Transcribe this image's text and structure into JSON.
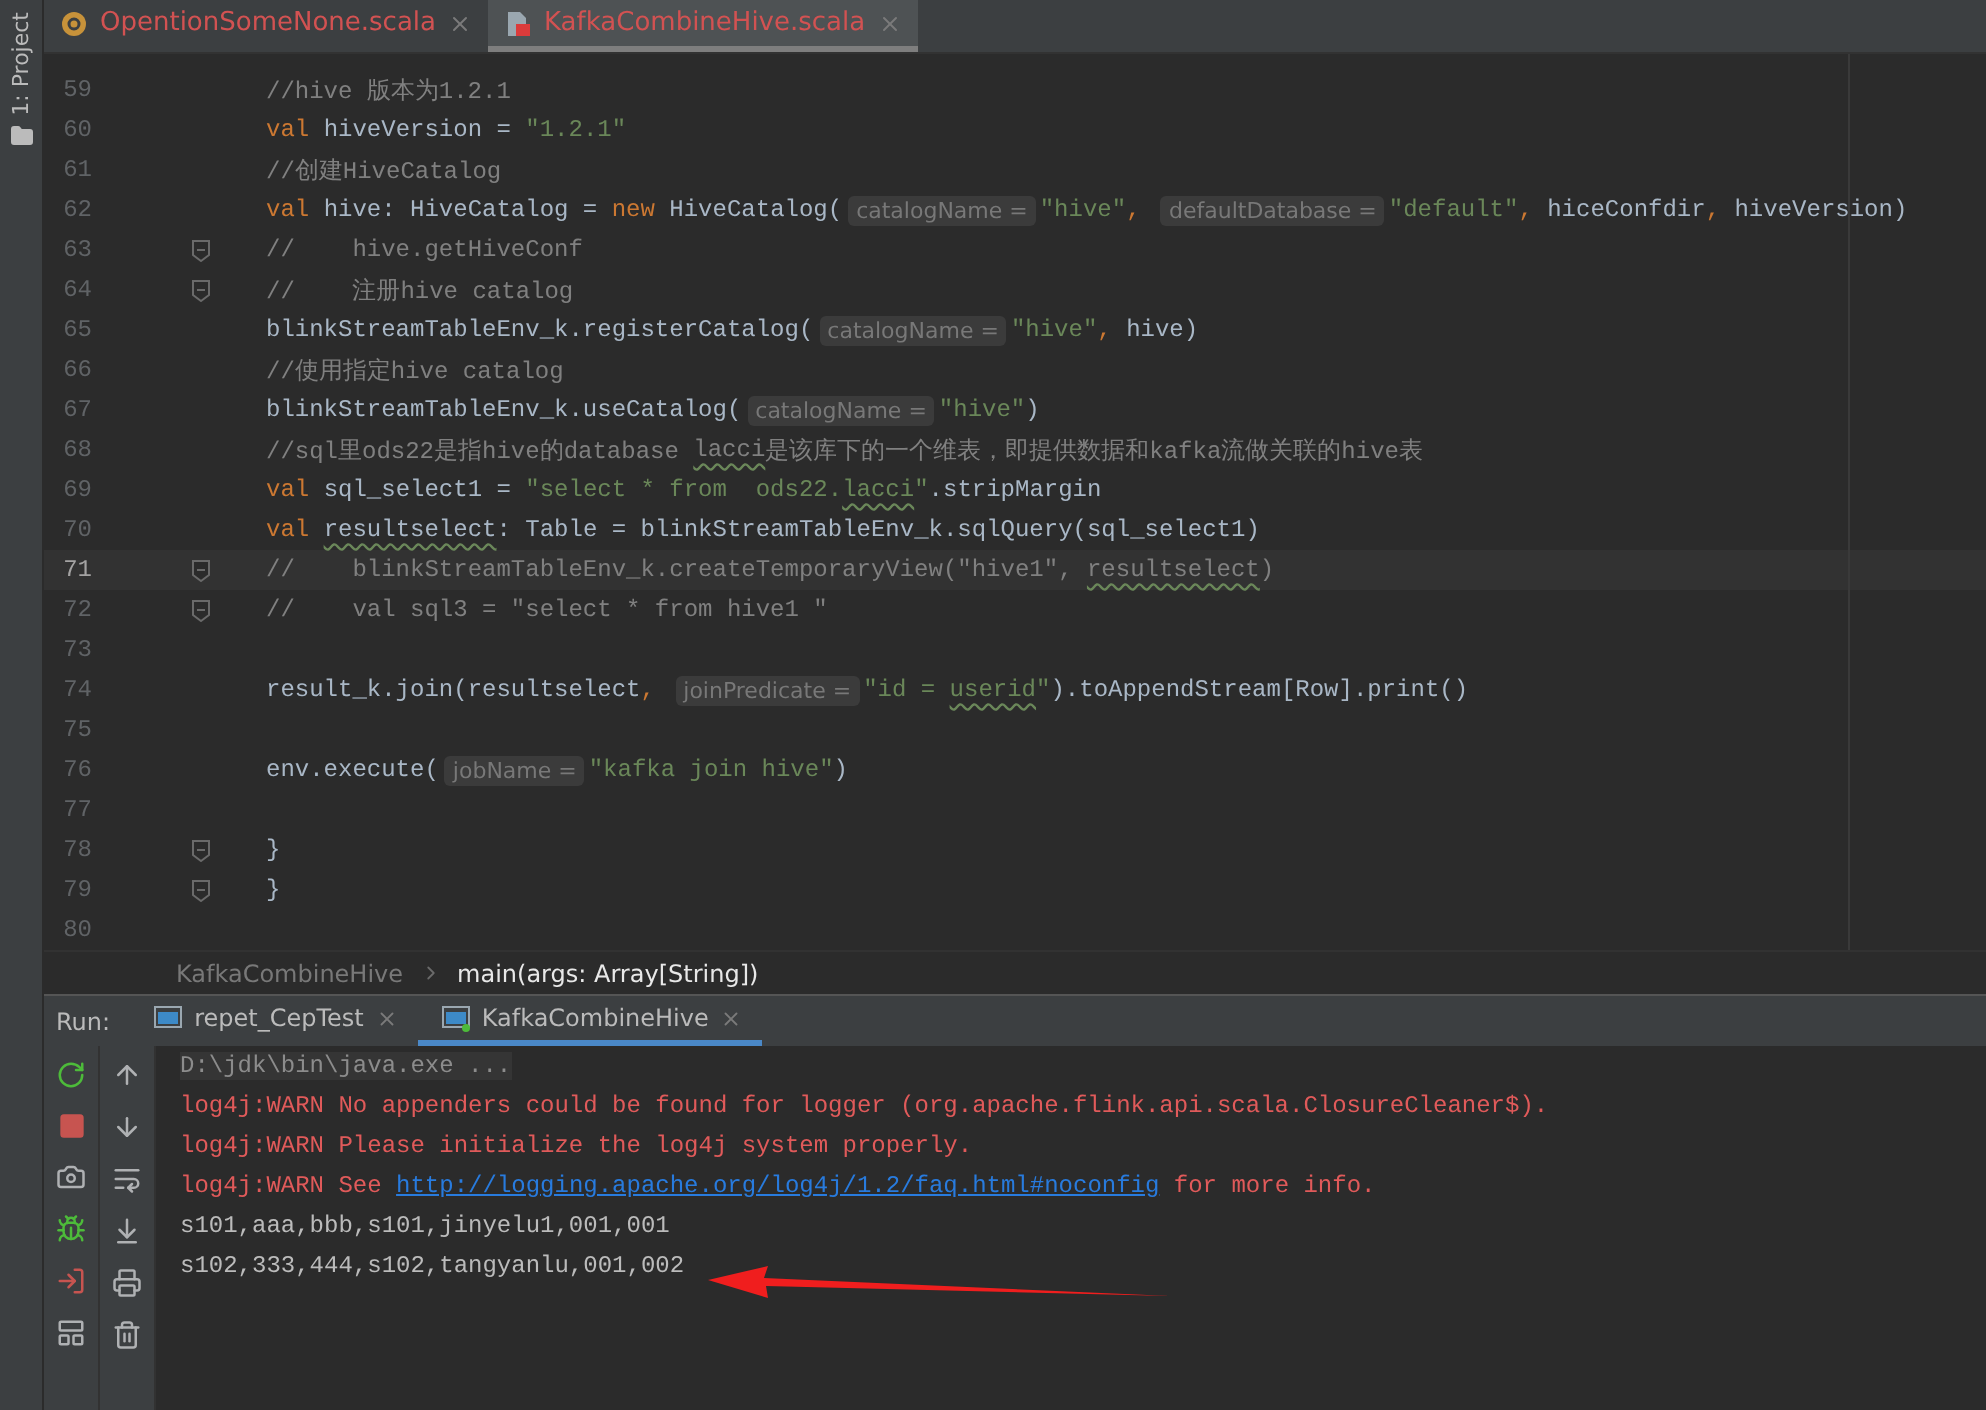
{
  "sidebar": {
    "label": "1: Project"
  },
  "editor_tabs": [
    {
      "label": "OpentionSomeNone.scala",
      "kind": "object",
      "selected": false
    },
    {
      "label": "KafkaCombineHive.scala",
      "kind": "file",
      "selected": true
    }
  ],
  "code_lines": [
    {
      "number": "59",
      "fold": false,
      "current": false,
      "tokens": [
        {
          "t": "//hive 版本为1.2.1",
          "kind": "comment"
        }
      ]
    },
    {
      "number": "60",
      "fold": false,
      "current": false,
      "tokens": [
        {
          "t": "val ",
          "kind": "keyword"
        },
        {
          "t": "hiveVersion = ",
          "kind": "text"
        },
        {
          "t": "\"1.2.1\"",
          "kind": "string"
        }
      ]
    },
    {
      "number": "61",
      "fold": false,
      "current": false,
      "tokens": [
        {
          "t": "//创建HiveCatalog",
          "kind": "comment"
        }
      ]
    },
    {
      "number": "62",
      "fold": false,
      "current": false,
      "tokens": [
        {
          "t": "val ",
          "kind": "keyword"
        },
        {
          "t": "hive: HiveCatalog = ",
          "kind": "text"
        },
        {
          "t": "new ",
          "kind": "keyword"
        },
        {
          "t": "HiveCatalog(",
          "kind": "text"
        },
        {
          "t": "catalogName =",
          "kind": "hint"
        },
        {
          "t": "\"hive\"",
          "kind": "string"
        },
        {
          "t": ", ",
          "kind": "keyword"
        },
        {
          "t": "defaultDatabase =",
          "kind": "hint"
        },
        {
          "t": "\"default\"",
          "kind": "string"
        },
        {
          "t": ", ",
          "kind": "keyword"
        },
        {
          "t": "hiceConfdir",
          "kind": "text"
        },
        {
          "t": ", ",
          "kind": "keyword"
        },
        {
          "t": "hiveVersion)",
          "kind": "text"
        }
      ]
    },
    {
      "number": "63",
      "fold": true,
      "current": false,
      "tokens": [
        {
          "t": "//    hive.getHiveConf",
          "kind": "comment"
        }
      ]
    },
    {
      "number": "64",
      "fold": true,
      "current": false,
      "tokens": [
        {
          "t": "//    注册hive catalog",
          "kind": "comment"
        }
      ]
    },
    {
      "number": "65",
      "fold": false,
      "current": false,
      "tokens": [
        {
          "t": "blinkStreamTableEnv_k.registerCatalog(",
          "kind": "text"
        },
        {
          "t": "catalogName =",
          "kind": "hint"
        },
        {
          "t": "\"hive\"",
          "kind": "string"
        },
        {
          "t": ", ",
          "kind": "keyword"
        },
        {
          "t": "hive)",
          "kind": "text"
        }
      ]
    },
    {
      "number": "66",
      "fold": false,
      "current": false,
      "tokens": [
        {
          "t": "//使用指定hive catalog",
          "kind": "comment"
        }
      ]
    },
    {
      "number": "67",
      "fold": false,
      "current": false,
      "tokens": [
        {
          "t": "blinkStreamTableEnv_k.useCatalog(",
          "kind": "text"
        },
        {
          "t": "catalogName =",
          "kind": "hint"
        },
        {
          "t": "\"hive\"",
          "kind": "string"
        },
        {
          "t": ")",
          "kind": "text"
        }
      ]
    },
    {
      "number": "68",
      "fold": false,
      "current": false,
      "tokens": [
        {
          "t": "//sql里ods22是指hive的database ",
          "kind": "comment",
          "warn": false
        },
        {
          "t": "lacci",
          "kind": "comment",
          "warn": true
        },
        {
          "t": "是该库下的一个维表，即提供数据和kafka流做关联的hive表",
          "kind": "comment",
          "warn": false
        }
      ]
    },
    {
      "number": "69",
      "fold": false,
      "current": false,
      "tokens": [
        {
          "t": "val ",
          "kind": "keyword",
          "warn": false
        },
        {
          "t": "sql_select1 = ",
          "kind": "text",
          "warn": false
        },
        {
          "t": "\"select * from  ods22.",
          "kind": "string",
          "warn": false
        },
        {
          "t": "lacci",
          "kind": "string",
          "warn": true
        },
        {
          "t": "\"",
          "kind": "string",
          "warn": false
        },
        {
          "t": ".stripMargin",
          "kind": "text",
          "warn": false
        }
      ]
    },
    {
      "number": "70",
      "fold": false,
      "current": false,
      "tokens": [
        {
          "t": "val ",
          "kind": "keyword",
          "warn": false
        },
        {
          "t": "resultselect",
          "kind": "text",
          "warn": true
        },
        {
          "t": ": Table = blinkStreamTableEnv_k.sqlQuery(sql_select1)",
          "kind": "text",
          "warn": false
        }
      ]
    },
    {
      "number": "71",
      "fold": true,
      "current": true,
      "tokens": [
        {
          "t": "//    blinkStreamTableEnv_k.createTemporaryView(\"hive1\", ",
          "kind": "comment",
          "warn": false
        },
        {
          "t": "resultselect",
          "kind": "comment",
          "warn": true
        },
        {
          "t": ")",
          "kind": "comment",
          "warn": false
        }
      ]
    },
    {
      "number": "72",
      "fold": true,
      "current": false,
      "tokens": [
        {
          "t": "//    val sql3 = \"select * from hive1 \"",
          "kind": "comment"
        }
      ]
    },
    {
      "number": "73",
      "fold": false,
      "current": false
    },
    {
      "number": "74",
      "fold": false,
      "current": false,
      "tokens": [
        {
          "t": "result_k.join(resultselect",
          "kind": "text",
          "warn": false
        },
        {
          "t": ", ",
          "kind": "keyword",
          "warn": false
        },
        {
          "t": "joinPredicate =",
          "kind": "hint"
        },
        {
          "t": "\"id = ",
          "kind": "string",
          "warn": false
        },
        {
          "t": "userid",
          "kind": "string",
          "warn": true
        },
        {
          "t": "\"",
          "kind": "string",
          "warn": false
        },
        {
          "t": ").toAppendStream[Row].print()",
          "kind": "text",
          "warn": false
        }
      ]
    },
    {
      "number": "75",
      "fold": false,
      "current": false
    },
    {
      "number": "76",
      "fold": false,
      "current": false,
      "tokens": [
        {
          "t": "env.execute(",
          "kind": "text"
        },
        {
          "t": "jobName =",
          "kind": "hint"
        },
        {
          "t": "\"kafka join hive\"",
          "kind": "string"
        },
        {
          "t": ")",
          "kind": "text"
        }
      ]
    },
    {
      "number": "77",
      "fold": false,
      "current": false
    },
    {
      "number": "78",
      "fold": true,
      "current": false,
      "tokens": [
        {
          "t": "}",
          "kind": "text"
        }
      ]
    },
    {
      "number": "79",
      "fold": true,
      "current": false,
      "tokens": [
        {
          "t": "}",
          "kind": "text"
        }
      ]
    },
    {
      "number": "80",
      "fold": false,
      "current": false
    }
  ],
  "breadcrumb": [
    {
      "label": "KafkaCombineHive",
      "selected": false
    },
    {
      "label": "main(args: Array[String])",
      "selected": true
    }
  ],
  "run_panel": {
    "label": "Run:",
    "tabs": [
      {
        "label": "repet_CepTest",
        "selected": false
      },
      {
        "label": "KafkaCombineHive",
        "selected": true
      }
    ]
  },
  "console_lines": [
    {
      "kind": "system",
      "text": "D:\\jdk\\bin\\java.exe ..."
    },
    {
      "kind": "error",
      "text": "log4j:WARN No appenders could be found for logger (org.apache.flink.api.scala.ClosureCleaner$)."
    },
    {
      "kind": "error",
      "text": "log4j:WARN Please initialize the log4j system properly."
    },
    {
      "kind": "error",
      "segments": [
        {
          "t": "log4j:WARN See ",
          "link": false
        },
        {
          "t": "http://logging.apache.org/log4j/1.2/faq.html#noconfig",
          "link": true
        },
        {
          "t": " for more info.",
          "link": false
        }
      ]
    },
    {
      "kind": "output",
      "text": "s101,aaa,bbb,s101,jinyelu1,001,001"
    },
    {
      "kind": "output",
      "text": "s102,333,444,s102,tangyanlu,001,002"
    }
  ]
}
